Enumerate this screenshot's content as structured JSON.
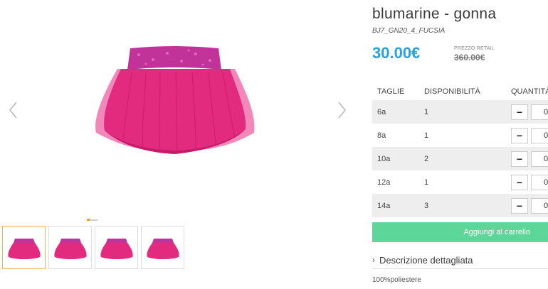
{
  "product": {
    "title": "blumarine - gonna",
    "sku": "BJ7_GN20_4_FUCSIA",
    "price": "30.00€",
    "retail_label": "PREZZO RETAIL",
    "retail_price": "360.00€"
  },
  "table": {
    "headers": [
      "TAGLIE",
      "DISPONIBILITÀ",
      "QUANTITÀ"
    ],
    "rows": [
      {
        "size": "6a",
        "availability": "1",
        "qty": "0"
      },
      {
        "size": "8a",
        "availability": "1",
        "qty": "0"
      },
      {
        "size": "10a",
        "availability": "2",
        "qty": "0"
      },
      {
        "size": "12a",
        "availability": "1",
        "qty": "0"
      },
      {
        "size": "14a",
        "availability": "3",
        "qty": "0"
      }
    ],
    "minus_symbol": "−"
  },
  "cart": {
    "add_label": "Aggiungi al carrello"
  },
  "description": {
    "heading": "Descrizione dettagliata",
    "chevron": "›",
    "body": "100%poliestere"
  },
  "colors": {
    "price": "#2aa1de",
    "cart_button": "#5dd799",
    "skirt": "#e8267f",
    "waistband": "#c2339a"
  },
  "icons": {
    "prev": "chevron-left-icon",
    "next": "chevron-right-icon"
  }
}
